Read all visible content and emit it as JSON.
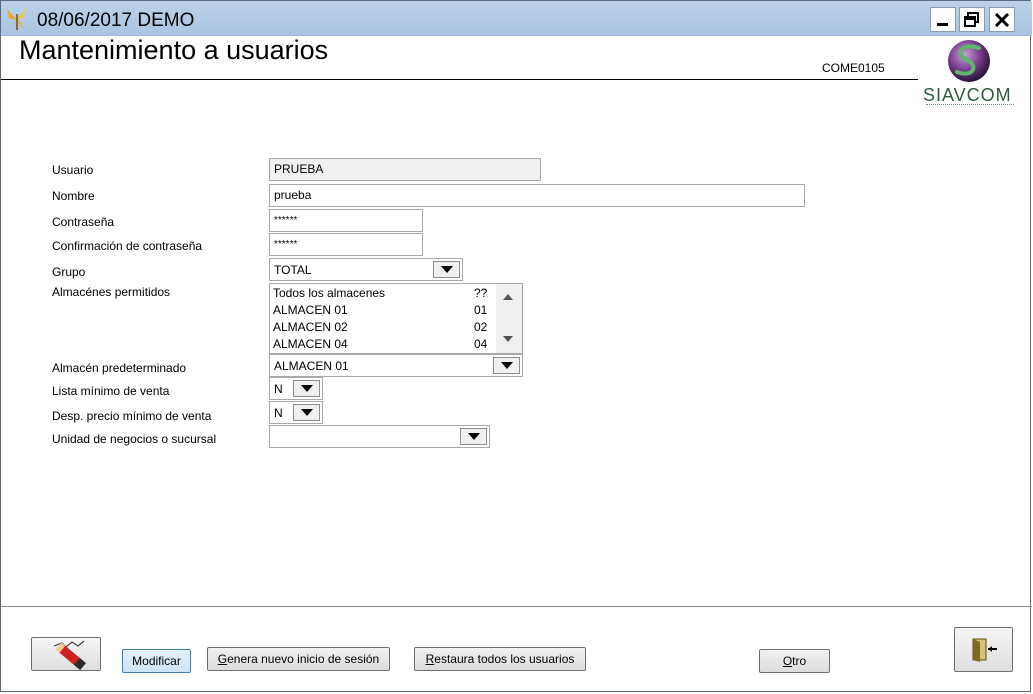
{
  "titlebar": {
    "title": "08/06/2017  DEMO",
    "icons": {
      "app": "butterfly-icon",
      "minimize": "minimize-icon",
      "restore": "restore-icon",
      "close": "close-icon"
    }
  },
  "header": {
    "title": "Mantenimiento a usuarios",
    "form_code": "COME0105",
    "logo_text": "SIAVCOM"
  },
  "form": {
    "usuario": {
      "label": "Usuario",
      "value": "PRUEBA"
    },
    "nombre": {
      "label": "Nombre",
      "value": "prueba"
    },
    "contrasena": {
      "label": "Contraseña",
      "value": "******"
    },
    "confirmacion": {
      "label": "Confirmación de contraseña",
      "value": "******"
    },
    "grupo": {
      "label": "Grupo",
      "value": "TOTAL"
    },
    "almacenes": {
      "label": "Almacénes permitidos",
      "items": [
        {
          "name": "Todos los almacenes",
          "code": "??"
        },
        {
          "name": "ALMACEN 01",
          "code": "01"
        },
        {
          "name": "ALMACEN 02",
          "code": "02"
        },
        {
          "name": "ALMACEN 04",
          "code": "04"
        }
      ]
    },
    "almacen_predeterminado": {
      "label": "Almacén predeterminado",
      "value": "ALMACEN 01"
    },
    "lista_minimo": {
      "label": "Lista mínimo de venta",
      "value": "N"
    },
    "desp_precio": {
      "label": "Desp. precio mínimo de venta",
      "value": "N"
    },
    "unidad_negocios": {
      "label": "Unidad de negocios o sucursal",
      "value": ""
    }
  },
  "footer": {
    "modificar_label": "Modificar",
    "genera_prefix": "G",
    "genera_rest": "enera nuevo inicio de sesión",
    "restaura_prefix": "R",
    "restaura_rest": "estaura todos los usuarios",
    "otro_prefix": "O",
    "otro_rest": "tro",
    "icons": {
      "edit": "eraser-pencil-icon",
      "exit": "exit-door-icon"
    }
  },
  "colors": {
    "titlebar": "#a9c4e2",
    "modificar_active": "#cde4f7",
    "logo": "#2f5a3a"
  }
}
